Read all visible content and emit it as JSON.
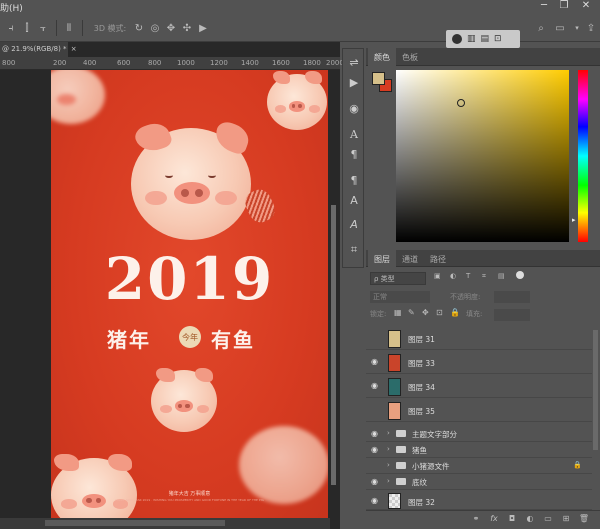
{
  "menubar": {
    "help_menu": "助(H)"
  },
  "window_controls": {
    "minimize": "─",
    "restore": "❐",
    "close": "✕"
  },
  "optbar": {
    "mode_3d_label": "3D 模式:"
  },
  "document": {
    "tab_title": "@ 21.9%(RGB/8) *",
    "tab_close": "×",
    "ruler_ticks": [
      "800",
      "200",
      "400",
      "600",
      "800",
      "1000",
      "1200",
      "1400",
      "1600",
      "1800",
      "2000"
    ]
  },
  "poster": {
    "year": "2019",
    "subtitle_left": "猪年",
    "subtitle_right": "有鱼",
    "seal_text": "今年",
    "footer_line1": "猪年大吉  万事顺意",
    "footer_line2": "HAPPY NEW YEAR 2019 · WISHING YOU PROSPERITY AND GOOD FORTUNE IN THE YEAR OF THE PIG"
  },
  "color_panel": {
    "tabs": [
      "颜色",
      "色板"
    ],
    "active_tab": "颜色",
    "foreground": "#d6c08a",
    "background": "#d73b21"
  },
  "layers_panel": {
    "tabs": [
      "图层",
      "通道",
      "路径"
    ],
    "active_tab": "图层",
    "filter_type": "ρ 类型",
    "blend_mode": "正常",
    "opacity_label": "不透明度:",
    "lock_label": "锁定:",
    "fill_label": "填充:",
    "layers": [
      {
        "name": "图层 31",
        "visible": false,
        "kind": "layer",
        "thumb": "#d6c08a"
      },
      {
        "name": "图层 33",
        "visible": true,
        "kind": "layer",
        "thumb": "#c9442a"
      },
      {
        "name": "图层 34",
        "visible": true,
        "kind": "layer",
        "thumb": "#2b6c6a"
      },
      {
        "name": "图层 35",
        "visible": false,
        "kind": "layer",
        "thumb": "#e8a07f"
      },
      {
        "name": "主题文字部分",
        "visible": true,
        "kind": "group"
      },
      {
        "name": "猪鱼",
        "visible": true,
        "kind": "group"
      },
      {
        "name": "小猪源文件",
        "visible": false,
        "kind": "group",
        "locked": true
      },
      {
        "name": "底纹",
        "visible": true,
        "kind": "group"
      },
      {
        "name": "图层 32",
        "visible": true,
        "kind": "layer",
        "thumb": "#eeeeee"
      }
    ]
  }
}
